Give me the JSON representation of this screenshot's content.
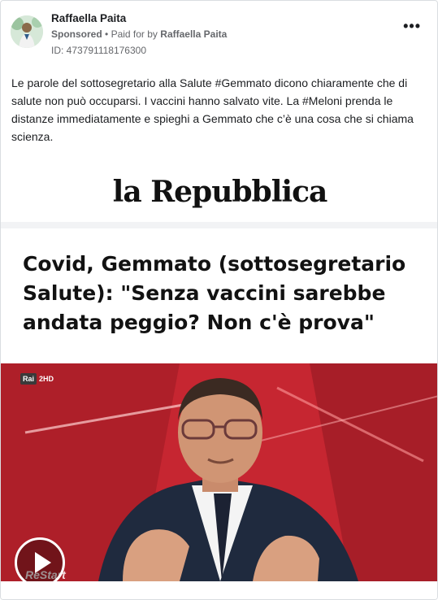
{
  "post": {
    "author": "Raffaella Paita",
    "sponsored_label": "Sponsored",
    "separator": "•",
    "paid_for_prefix": "Paid for by",
    "paid_for_name": "Raffaella Paita",
    "ad_id": "ID: 473791118176300",
    "more_label": "•••",
    "text": "Le parole del sottosegretario alla Salute #Gemmato dicono chiaramente che di salute non può occuparsi. I vaccini hanno salvato vite. La #Meloni prenda le distanze immediatamente e spieghi a Gemmato che c’è una cosa che si chiama scienza."
  },
  "media": {
    "logo": "la Repubblica",
    "headline": "Covid, Gemmato (sottosegretario Salute): \"Senza vaccini sarebbe andata peggio? Non c'è prova\"",
    "channel_brand": "Rai",
    "channel_name": "2HD",
    "watermark": "ReStart"
  },
  "colors": {
    "studio_red": "#c8242f",
    "text_primary": "#1c1e21",
    "text_secondary": "#65676b"
  },
  "icons": {
    "more": "more-options-icon",
    "play": "play-icon"
  }
}
